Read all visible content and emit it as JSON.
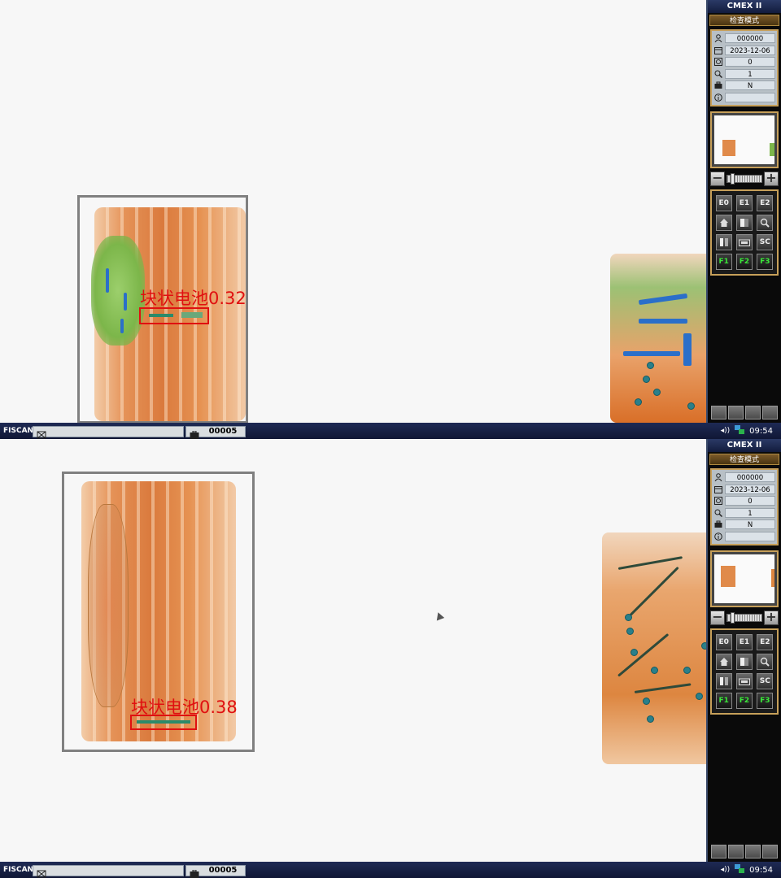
{
  "screens": [
    {
      "detection": {
        "label": "块状电池0.32"
      },
      "status": {
        "brand": "FISCAN",
        "counter": "00005",
        "time": "09:54"
      },
      "panel": {
        "title": "CMEX II",
        "mode": "检查模式",
        "info": {
          "operator_id": "000000",
          "date": "2023-12-06",
          "count": "0",
          "zoom": "1",
          "bag_type": "N",
          "info": ""
        },
        "buttons": [
          "E0",
          "E1",
          "E2",
          "home-icon",
          "contrast-icon",
          "magnify-icon",
          "book-icon",
          "bag-icon",
          "SC",
          "F1",
          "F2",
          "F3"
        ]
      }
    },
    {
      "detection": {
        "label": "块状电池0.38"
      },
      "status": {
        "brand": "FISCAN",
        "counter": "00005",
        "time": "09:54"
      },
      "panel": {
        "title": "CMEX II",
        "mode": "检查模式",
        "info": {
          "operator_id": "000000",
          "date": "2023-12-06",
          "count": "0",
          "zoom": "1",
          "bag_type": "N",
          "info": ""
        },
        "buttons": [
          "E0",
          "E1",
          "E2",
          "home-icon",
          "contrast-icon",
          "magnify-icon",
          "book-icon",
          "bag-icon",
          "SC",
          "F1",
          "F2",
          "F3"
        ]
      }
    }
  ],
  "colors": {
    "detection": "#e01010",
    "panel_accent": "#c7a05a",
    "status_bar": "#1e2a55",
    "function_key_text": "#39e639"
  }
}
